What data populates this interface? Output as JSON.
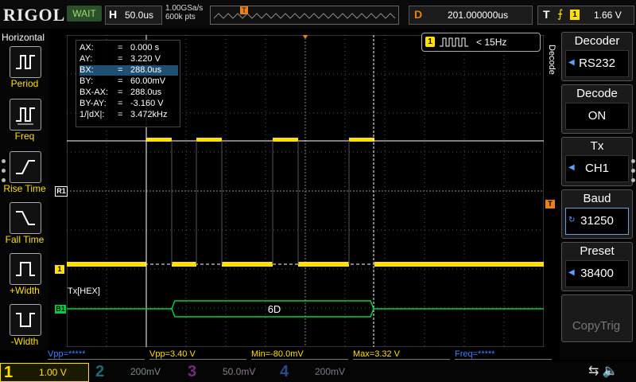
{
  "brand": "RIGOL",
  "status": "WAIT",
  "timebase": {
    "label": "H",
    "value": "50.0us"
  },
  "sample_rate": "1.00GSa/s",
  "memory_depth": "600k pts",
  "delay": {
    "label": "D",
    "value": "201.000000us"
  },
  "trigger": {
    "label": "T",
    "channel": "1",
    "level": "1.66 V"
  },
  "left_menu": {
    "title": "Horizontal",
    "items": [
      "Period",
      "Freq",
      "Rise Time",
      "Fall Time",
      "+Width",
      "-Width"
    ]
  },
  "cursor_table": [
    {
      "key": "AX:",
      "value": "0.000 s"
    },
    {
      "key": "AY:",
      "value": "3.220 V"
    },
    {
      "key": "BX:",
      "value": "288.0us"
    },
    {
      "key": "BY:",
      "value": "60.00mV"
    },
    {
      "key": "BX-AX:",
      "value": "288.0us"
    },
    {
      "key": "BY-AY:",
      "value": "-3.160 V"
    },
    {
      "key": "1/|dX|:",
      "value": "3.472kHz"
    }
  ],
  "freq_counter": {
    "channel": "1",
    "value": "< 15Hz"
  },
  "bus": {
    "label": "Tx[HEX]",
    "decoded": "6D",
    "marker": "B1"
  },
  "channel_markers": {
    "ref": "R1",
    "ch1": "1"
  },
  "bottom_measures": {
    "vpp_left": "Vpp=*****",
    "vpp": "Vpp=3.40 V",
    "min": "Min=-80.0mV",
    "max": "Max=3.32 V",
    "freq": "Freq=*****"
  },
  "channels": [
    {
      "num": "1",
      "scale": "1.00 V"
    },
    {
      "num": "2",
      "scale": "200mV"
    },
    {
      "num": "3",
      "scale": "50.0mV"
    },
    {
      "num": "4",
      "scale": "200mV"
    }
  ],
  "right_menu": {
    "title": "Decode",
    "items": [
      {
        "label": "Decoder",
        "value": "RS232"
      },
      {
        "label": "Decode",
        "value": "ON"
      },
      {
        "label": "Tx",
        "value": "CH1"
      },
      {
        "label": "Baud",
        "value": "31250"
      },
      {
        "label": "Preset",
        "value": "38400"
      },
      {
        "label": "",
        "value": "CopyTrig"
      }
    ]
  },
  "colors": {
    "ch1": "#ffe000",
    "ch2": "#00e0ff",
    "ch3": "#ff40ff",
    "ch4": "#3f7fff",
    "bus": "#00d040",
    "trigger": "#e9801b"
  }
}
